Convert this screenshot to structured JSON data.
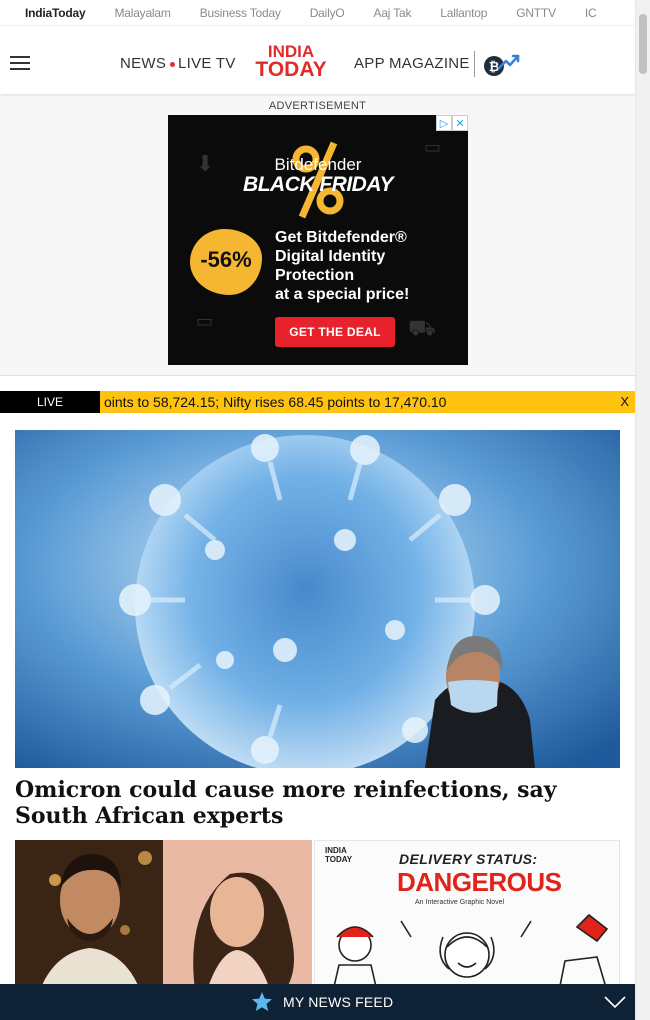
{
  "network_bar": {
    "links": [
      "IndiaToday",
      "Malayalam",
      "Business Today",
      "DailyO",
      "Aaj Tak",
      "Lallantop",
      "GNTTV",
      "IC"
    ]
  },
  "header": {
    "menu_icon": "hamburger-icon",
    "news_label": "NEWS",
    "live_tv_label": "LIVE TV",
    "logo_line1": "INDIA",
    "logo_line2": "TODAY",
    "app_label": "APP",
    "magazine_label": "MAGAZINE",
    "crypto_icon": "bitcoin-trend-icon",
    "logo_color": "#e32b2b"
  },
  "ad": {
    "label": "ADVERTISEMENT",
    "brand": "Bitdefender",
    "event": "BLACK FRIDAY",
    "discount": "-56%",
    "copy_lines": [
      "Get Bitdefender®",
      "Digital Identity",
      "Protection",
      "at a special price!"
    ],
    "cta": "GET THE DEAL",
    "cta_color": "#e8222c",
    "badge_color": "#f5b731"
  },
  "ticker": {
    "badge": "LIVE",
    "text": "oints to 58,724.15; Nifty rises 68.45 points to 17,470.10",
    "close": "X",
    "color": "#ffc20e"
  },
  "hero": {
    "headline": "Omicron could cause more reinfections, say South African experts"
  },
  "thumbs": {
    "second": {
      "logo_line1": "INDIA",
      "logo_line2": "TODAY",
      "status": "DELIVERY STATUS:",
      "danger": "DANGEROUS",
      "sub": "An Interactive Graphic Novel"
    }
  },
  "feed_bar": {
    "label": "MY NEWS FEED",
    "star_icon": "star-icon",
    "chevron_icon": "chevron-down-icon",
    "bg_color": "#0f2235"
  }
}
